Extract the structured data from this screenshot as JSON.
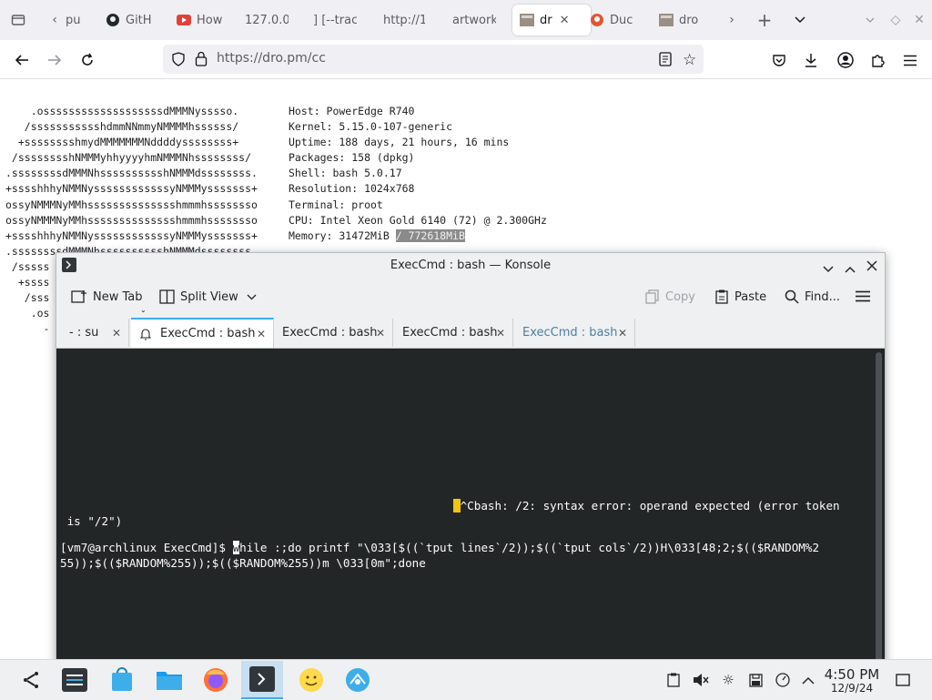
{
  "browser": {
    "tabs": [
      {
        "label": "pu",
        "icon": "blank-page-icon"
      },
      {
        "label": "GitH",
        "icon": "github-icon"
      },
      {
        "label": "How",
        "icon": "youtube-icon"
      },
      {
        "label": "127.0.0",
        "icon": "blank-page-icon"
      },
      {
        "label": "] [--trac",
        "icon": "blank-page-icon"
      },
      {
        "label": "http://1",
        "icon": "blank-page-icon"
      },
      {
        "label": "artwork",
        "icon": "blank-page-icon"
      },
      {
        "label": "dr",
        "icon": "page-thumbnail-icon",
        "active": true
      },
      {
        "label": "Duc",
        "icon": "duckduckgo-icon"
      },
      {
        "label": "dro",
        "icon": "page-thumbnail-icon"
      }
    ],
    "url": "https://dro.pm/cc"
  },
  "neofetch": {
    "ascii_lines": [
      "    .osssssssssssssssssssdMMMNysssso.",
      "   /ssssssssssshdmmNNmmyNMMMMhssssss/",
      "  +sssssssshmydMMMMMMMNddddyssssssss+",
      " /sssssssshNMMMyhhyyyyhmNMMMNhssssssss/",
      ".ssssssssdMMMNhsssssssssshNMMMdssssssss.",
      "+sssshhhyNMMNyssssssssssssyNMMMysssssss+",
      "ossyNMMMNyMMhsssssssssssssshmmmhssssssso",
      "ossyNMMMNyMMhsssssssssssssshmmmhssssssso",
      "+sssshhhyNMMNyssssssssssssyNMMMysssssss+",
      ".ssssssssdMMMNhsssssssssshNMMMdssssssss.",
      " /sssss",
      "  +ssss",
      "   /sss",
      "    .os",
      "      -"
    ],
    "info": {
      "host": "Host: PowerEdge R740",
      "kernel": "Kernel: 5.15.0-107-generic",
      "uptime": "Uptime: 188 days, 21 hours, 16 mins",
      "packages": "Packages: 158 (dpkg)",
      "shell": "Shell: bash 5.0.17",
      "resolution": "Resolution: 1024x768",
      "terminal": "Terminal: proot",
      "cpu": "CPU: Intel Xeon Gold 6140 (72) @ 2.300GHz",
      "memory_label": "Memory: 31472MiB ",
      "memory_total": "/ 772618MiB"
    }
  },
  "konsole": {
    "title": "ExecCmd : bash — Konsole",
    "toolbar": {
      "new_tab": "New Tab",
      "split_view": "Split View",
      "copy": "Copy",
      "paste": "Paste",
      "find": "Find..."
    },
    "tabs": [
      {
        "label": "- : su"
      },
      {
        "label": "ExecCmd : bash",
        "active": true
      },
      {
        "label": "ExecCmd : bash"
      },
      {
        "label": "ExecCmd : bash"
      },
      {
        "label": "ExecCmd : bash",
        "dim": true
      }
    ],
    "terminal": {
      "line1": "^Cbash: /2: syntax error: operand expected (error token",
      "line2": " is \"/2\")",
      "prompt": "[vm7@archlinux ExecCmd]$ ",
      "cmd_first_char": "w",
      "cmd_rest": "hile :;do printf \"\\033[$((`tput lines`/2));$((`tput cols`/2))H\\033[48;2;$(($RANDOM%2",
      "line4": "55));$(($RANDOM%255));$(($RANDOM%255))m \\033[0m\";done"
    }
  },
  "taskbar": {
    "time": "4:50 PM",
    "date": "12/9/24"
  },
  "colors": {
    "terminal_bg": "#232627",
    "accent": "#3daee9",
    "browser_chrome": "#f0f0f4"
  }
}
